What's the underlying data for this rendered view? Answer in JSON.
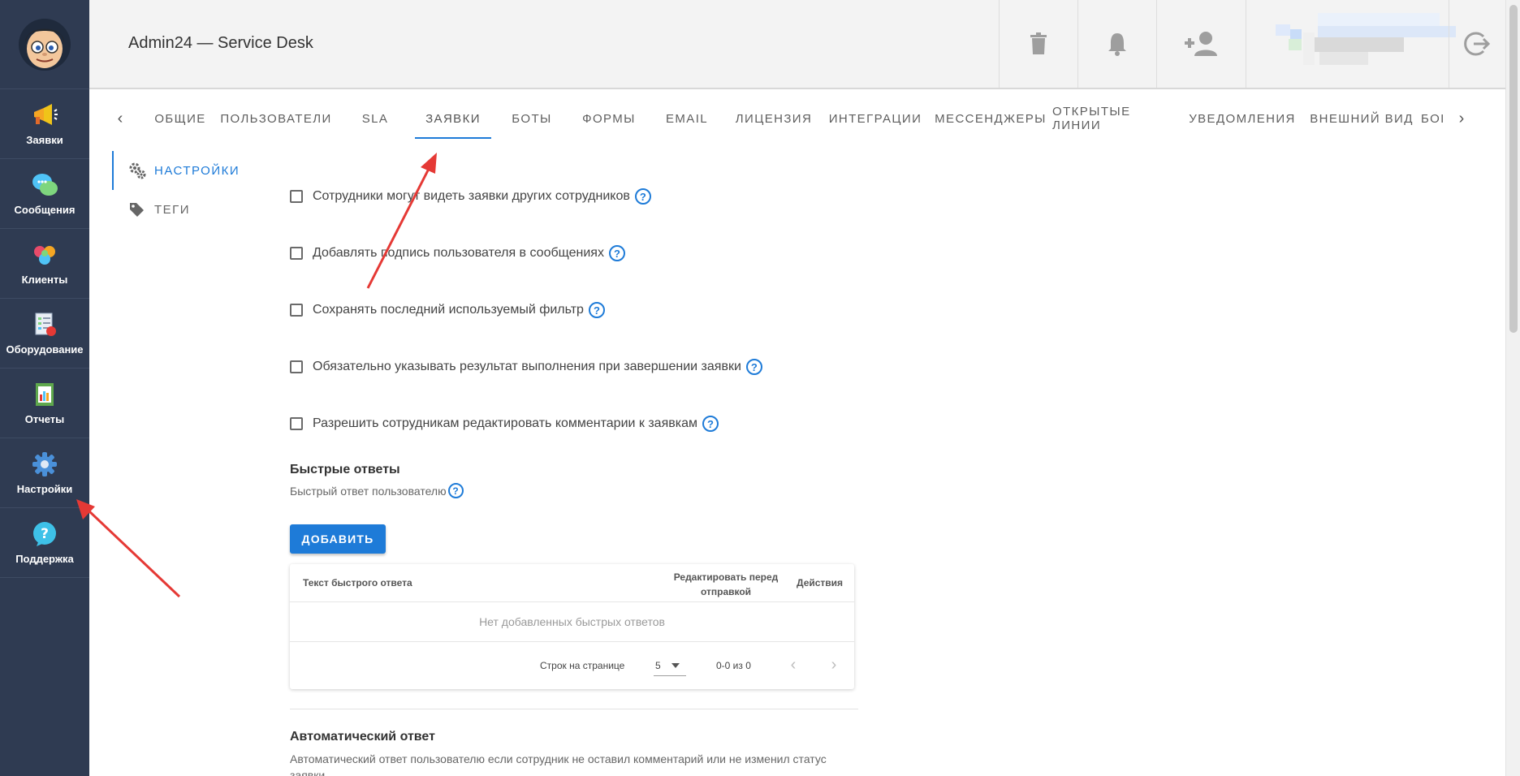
{
  "header": {
    "title": "Admin24 — Service Desk"
  },
  "sidebar": {
    "items": [
      {
        "label": "Заявки",
        "icon": "megaphone-icon"
      },
      {
        "label": "Сообщения",
        "icon": "chat-bubbles-icon"
      },
      {
        "label": "Клиенты",
        "icon": "clients-hearts-icon"
      },
      {
        "label": "Оборудование",
        "icon": "equipment-checklist-icon"
      },
      {
        "label": "Отчеты",
        "icon": "report-chart-icon"
      },
      {
        "label": "Настройки",
        "icon": "gear-icon"
      },
      {
        "label": "Поддержка",
        "icon": "question-bubble-icon"
      }
    ]
  },
  "tabs": [
    {
      "label": "ОБЩИЕ"
    },
    {
      "label": "ПОЛЬЗОВАТЕЛИ"
    },
    {
      "label": "SLA"
    },
    {
      "label": "ЗАЯВКИ",
      "active": true
    },
    {
      "label": "БОТЫ"
    },
    {
      "label": "ФОРМЫ"
    },
    {
      "label": "EMAIL"
    },
    {
      "label": "ЛИЦЕНЗИЯ"
    },
    {
      "label": "ИНТЕГРАЦИИ"
    },
    {
      "label": "МЕССЕНДЖЕРЫ"
    },
    {
      "label": "ОТКРЫТЫЕ ЛИНИИ"
    },
    {
      "label": "УВЕДОМЛЕНИЯ"
    },
    {
      "label": "ВНЕШНИЙ ВИД"
    },
    {
      "label": "БОІ"
    }
  ],
  "submenu": {
    "items": [
      {
        "label": "НАСТРОЙКИ",
        "active": true
      },
      {
        "label": "ТЕГИ"
      }
    ]
  },
  "settings": {
    "checkboxes": [
      {
        "label": "Сотрудники могут видеть заявки других сотрудников",
        "checked": false
      },
      {
        "label": "Добавлять подпись пользователя в сообщениях",
        "checked": false
      },
      {
        "label": "Сохранять последний используемый фильтр",
        "checked": false
      },
      {
        "label": "Обязательно указывать результат выполнения при завершении заявки",
        "checked": false
      },
      {
        "label": "Разрешить сотрудникам редактировать комментарии к заявкам",
        "checked": false
      }
    ],
    "help_glyph": "?"
  },
  "quick_replies": {
    "title": "Быстрые ответы",
    "subtitle": "Быстрый ответ пользователю",
    "add_label": "ДОБАВИТЬ",
    "table": {
      "col_text": "Текст быстрого ответа",
      "col_edit_line1": "Редактировать перед",
      "col_edit_line2": "отправкой",
      "col_actions": "Действия",
      "empty": "Нет добавленных быстрых ответов",
      "rows_per_page_label": "Строк на странице",
      "rows_per_page_value": "5",
      "range": "0-0 из 0"
    }
  },
  "auto_reply": {
    "title": "Автоматический ответ",
    "desc_line1": "Автоматический ответ пользователю если сотрудник не оставил комментарий или не изменил статус",
    "desc_line2": "заявки"
  },
  "colors": {
    "sidebar_bg": "#2f3b52",
    "accent": "#1e7bd8",
    "annotation_arrow": "#e53935"
  }
}
